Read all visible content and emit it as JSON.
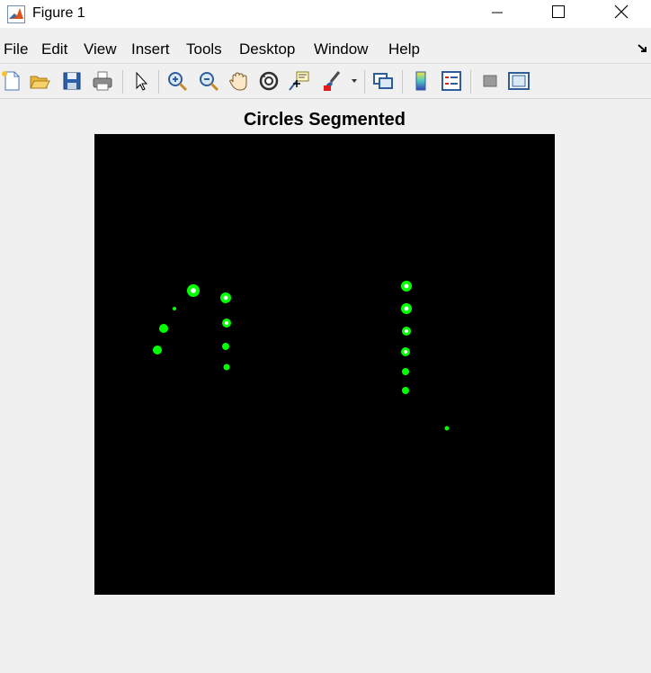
{
  "window": {
    "title": "Figure 1",
    "icon": "matlab-icon",
    "controls": [
      "minimize-icon",
      "maximize-icon",
      "close-icon"
    ]
  },
  "menu": {
    "items": [
      "File",
      "Edit",
      "View",
      "Insert",
      "Tools",
      "Desktop",
      "Window",
      "Help"
    ]
  },
  "toolbar": {
    "icons": [
      "new-figure-icon",
      "open-file-icon",
      "save-icon",
      "print-icon",
      "select-arrow-icon",
      "zoom-in-icon",
      "zoom-out-icon",
      "pan-icon",
      "rotate-3d-icon",
      "data-cursor-icon",
      "brush-icon",
      "dropdown-arrow-icon",
      "link-plot-icon",
      "colorbar-icon",
      "legend-icon",
      "hide-plot-tools-icon",
      "show-plot-tools-icon"
    ]
  },
  "figure": {
    "title": "Circles Segmented",
    "background": "#000000",
    "mark_color": "#00ff00",
    "highlight_color": "#ffffff"
  },
  "chart_data": {
    "type": "scatter",
    "title": "Circles Segmented",
    "xlabel": "",
    "ylabel": "",
    "xlim": [
      0,
      512
    ],
    "ylim": [
      0,
      512
    ],
    "y_direction": "down",
    "grid": false,
    "series": [
      {
        "points": [
          {
            "x": 110,
            "y": 174,
            "r": 7,
            "highlight": true
          },
          {
            "x": 146,
            "y": 182,
            "r": 6,
            "highlight": true
          },
          {
            "x": 89,
            "y": 194,
            "r": 2,
            "highlight": false
          },
          {
            "x": 147,
            "y": 210,
            "r": 5,
            "highlight": true
          },
          {
            "x": 77,
            "y": 216,
            "r": 5,
            "highlight": false
          },
          {
            "x": 146,
            "y": 236,
            "r": 4,
            "highlight": false
          },
          {
            "x": 70,
            "y": 240,
            "r": 5,
            "highlight": false
          },
          {
            "x": 147,
            "y": 259,
            "r": 3.5,
            "highlight": false
          },
          {
            "x": 347,
            "y": 169,
            "r": 6,
            "highlight": true
          },
          {
            "x": 347,
            "y": 194,
            "r": 6,
            "highlight": true
          },
          {
            "x": 347,
            "y": 219,
            "r": 5,
            "highlight": true
          },
          {
            "x": 346,
            "y": 242,
            "r": 5,
            "highlight": true
          },
          {
            "x": 346,
            "y": 264,
            "r": 4,
            "highlight": false
          },
          {
            "x": 346,
            "y": 285,
            "r": 4,
            "highlight": false
          },
          {
            "x": 392,
            "y": 327,
            "r": 2.5,
            "highlight": false
          }
        ]
      }
    ]
  }
}
